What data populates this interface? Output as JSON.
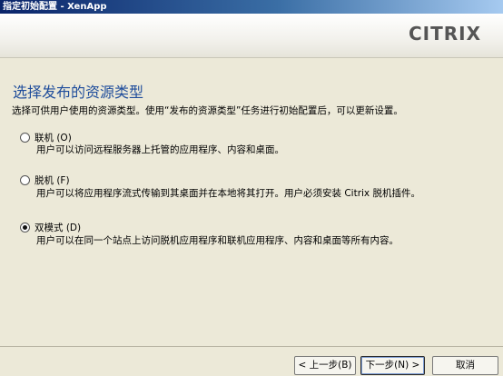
{
  "window": {
    "title": "指定初始配置 - XenApp"
  },
  "header": {
    "logo": "CITRIX"
  },
  "page": {
    "heading": "选择发布的资源类型",
    "intro": "选择可供用户使用的资源类型。使用“发布的资源类型”任务进行初始配置后，可以更新设置。"
  },
  "options": [
    {
      "label": "联机 (O)",
      "description": "用户可以访问远程服务器上托管的应用程序、内容和桌面。",
      "selected": false
    },
    {
      "label": "脱机 (F)",
      "description": "用户可以将应用程序流式传输到其桌面并在本地将其打开。用户必须安装 Citrix 脱机插件。",
      "selected": false
    },
    {
      "label": "双模式 (D)",
      "description": "用户可以在同一个站点上访问脱机应用程序和联机应用程序、内容和桌面等所有内容。",
      "selected": true
    }
  ],
  "buttons": {
    "back": "< 上一步(B)",
    "next": "下一步(N) >",
    "cancel": "取消"
  }
}
